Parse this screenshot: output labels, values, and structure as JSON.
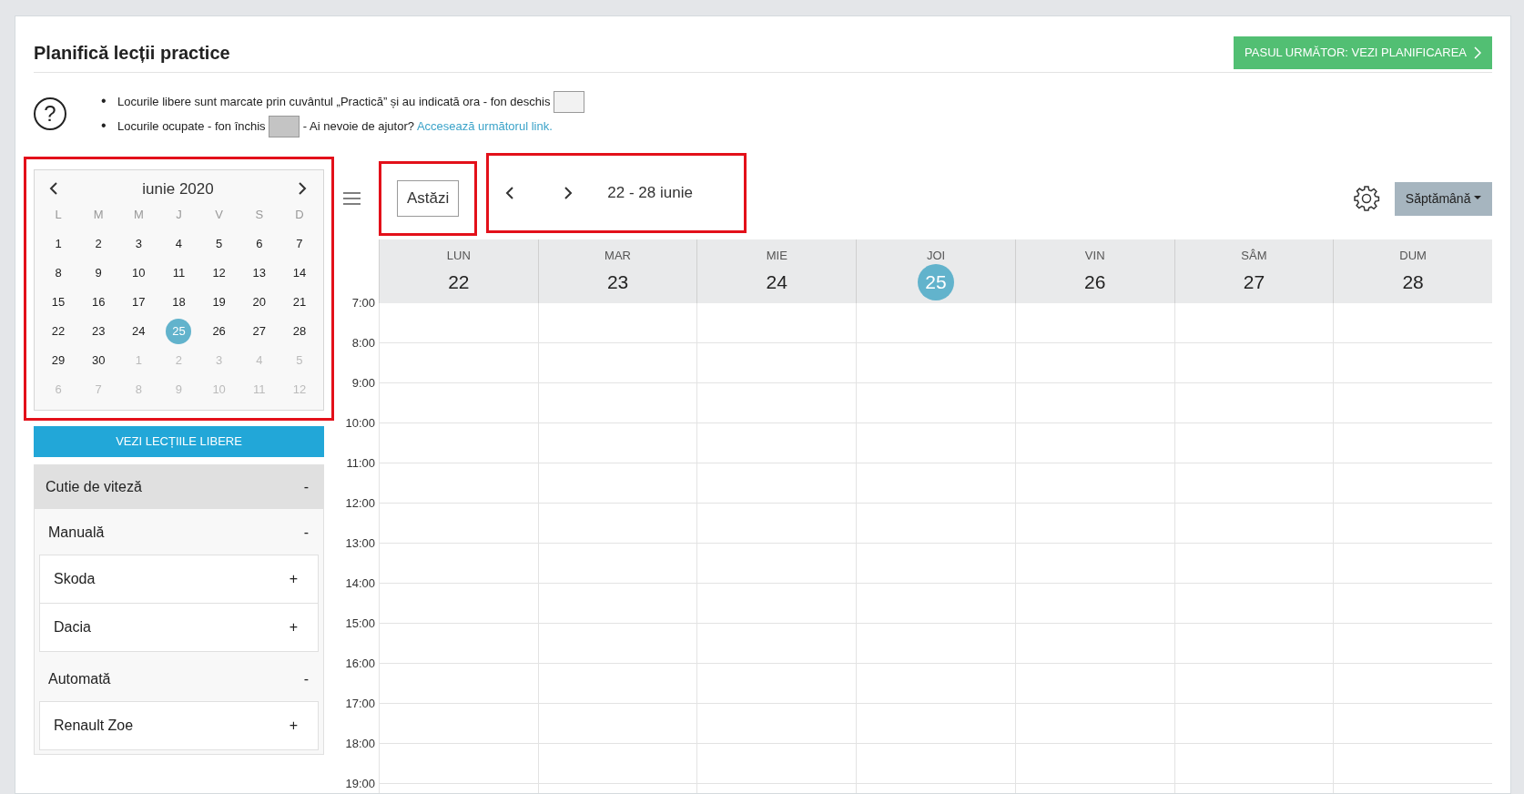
{
  "title": "Planifică lecții practice",
  "next_button": "PASUL URMĂTOR: VEZI PLANIFICAREA",
  "help_icon": "?",
  "legend": [
    {
      "bullet": "•",
      "text": "Locurile libere sunt marcate prin cuvântul „Practică” și au indicată ora - fon deschis",
      "color": "#f2f2f2"
    },
    {
      "bullet": "•",
      "text": "Locurile ocupate - fon închis",
      "color": "#c4c4c4",
      "after": "- Ai nevoie de ajutor?",
      "link": "Accesează următorul link."
    }
  ],
  "mini_calendar": {
    "month": "iunie 2020",
    "weekdays": [
      "L",
      "M",
      "M",
      "J",
      "V",
      "S",
      "D"
    ],
    "weeks": [
      [
        {
          "day": "1",
          "other_month": false,
          "selected": false
        },
        {
          "day": "2",
          "other_month": false,
          "selected": false
        },
        {
          "day": "3",
          "other_month": false,
          "selected": false
        },
        {
          "day": "4",
          "other_month": false,
          "selected": false
        },
        {
          "day": "5",
          "other_month": false,
          "selected": false
        },
        {
          "day": "6",
          "other_month": false,
          "selected": false
        },
        {
          "day": "7",
          "other_month": false,
          "selected": false
        }
      ],
      [
        {
          "day": "8",
          "other_month": false,
          "selected": false
        },
        {
          "day": "9",
          "other_month": false,
          "selected": false
        },
        {
          "day": "10",
          "other_month": false,
          "selected": false
        },
        {
          "day": "11",
          "other_month": false,
          "selected": false
        },
        {
          "day": "12",
          "other_month": false,
          "selected": false
        },
        {
          "day": "13",
          "other_month": false,
          "selected": false
        },
        {
          "day": "14",
          "other_month": false,
          "selected": false
        }
      ],
      [
        {
          "day": "15",
          "other_month": false,
          "selected": false
        },
        {
          "day": "16",
          "other_month": false,
          "selected": false
        },
        {
          "day": "17",
          "other_month": false,
          "selected": false
        },
        {
          "day": "18",
          "other_month": false,
          "selected": false
        },
        {
          "day": "19",
          "other_month": false,
          "selected": false
        },
        {
          "day": "20",
          "other_month": false,
          "selected": false
        },
        {
          "day": "21",
          "other_month": false,
          "selected": false
        }
      ],
      [
        {
          "day": "22",
          "other_month": false,
          "selected": false
        },
        {
          "day": "23",
          "other_month": false,
          "selected": false
        },
        {
          "day": "24",
          "other_month": false,
          "selected": false
        },
        {
          "day": "25",
          "other_month": false,
          "selected": true
        },
        {
          "day": "26",
          "other_month": false,
          "selected": false
        },
        {
          "day": "27",
          "other_month": false,
          "selected": false
        },
        {
          "day": "28",
          "other_month": false,
          "selected": false
        }
      ],
      [
        {
          "day": "29",
          "other_month": false,
          "selected": false
        },
        {
          "day": "30",
          "other_month": false,
          "selected": false
        },
        {
          "day": "1",
          "other_month": true,
          "selected": false
        },
        {
          "day": "2",
          "other_month": true,
          "selected": false
        },
        {
          "day": "3",
          "other_month": true,
          "selected": false
        },
        {
          "day": "4",
          "other_month": true,
          "selected": false
        },
        {
          "day": "5",
          "other_month": true,
          "selected": false
        }
      ],
      [
        {
          "day": "6",
          "other_month": true,
          "selected": false
        },
        {
          "day": "7",
          "other_month": true,
          "selected": false
        },
        {
          "day": "8",
          "other_month": true,
          "selected": false
        },
        {
          "day": "9",
          "other_month": true,
          "selected": false
        },
        {
          "day": "10",
          "other_month": true,
          "selected": false
        },
        {
          "day": "11",
          "other_month": true,
          "selected": false
        },
        {
          "day": "12",
          "other_month": true,
          "selected": false
        }
      ]
    ]
  },
  "free_lessons_button": "VEZI LECȚIILE LIBERE",
  "filter": {
    "title": "Cutie de viteză",
    "toggle": "-",
    "groups": [
      {
        "label": "Manuală",
        "toggle": "-",
        "children": [
          {
            "label": "Skoda",
            "toggle": "+"
          },
          {
            "label": "Dacia",
            "toggle": "+"
          }
        ]
      },
      {
        "label": "Automată",
        "toggle": "-",
        "children": [
          {
            "label": "Renault Zoe",
            "toggle": "+"
          }
        ]
      }
    ]
  },
  "calendar": {
    "today_button": "Astăzi",
    "range": "22 - 28 iunie",
    "view": "Săptămână",
    "days": [
      {
        "weekday": "LUN",
        "date": "22",
        "today": false
      },
      {
        "weekday": "MAR",
        "date": "23",
        "today": false
      },
      {
        "weekday": "MIE",
        "date": "24",
        "today": false
      },
      {
        "weekday": "JOI",
        "date": "25",
        "today": true
      },
      {
        "weekday": "VIN",
        "date": "26",
        "today": false
      },
      {
        "weekday": "SÂM",
        "date": "27",
        "today": false
      },
      {
        "weekday": "DUM",
        "date": "28",
        "today": false
      }
    ],
    "hours": [
      "7:00",
      "8:00",
      "9:00",
      "10:00",
      "11:00",
      "12:00",
      "13:00",
      "14:00",
      "15:00",
      "16:00",
      "17:00",
      "18:00",
      "19:00"
    ]
  }
}
